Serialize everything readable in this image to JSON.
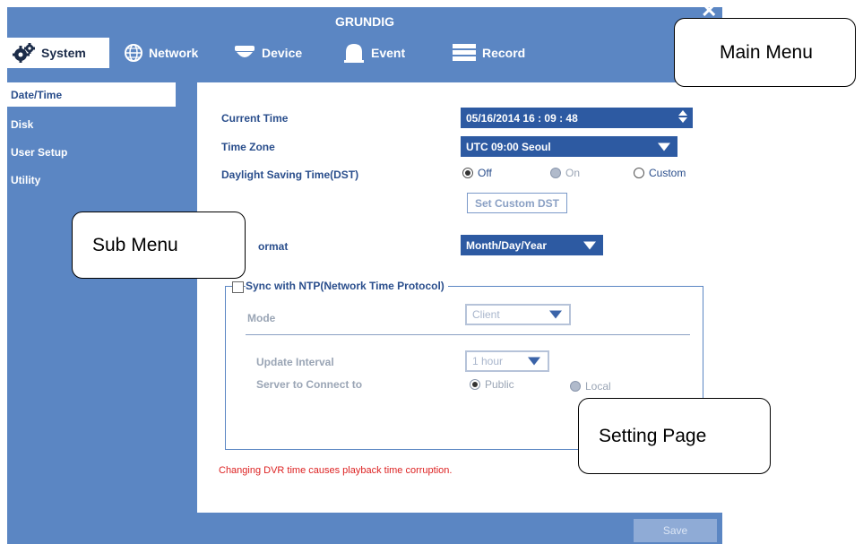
{
  "window": {
    "title": "GRUNDIG",
    "close_glyph": "✕"
  },
  "main_menu": [
    {
      "label": "System",
      "icon": "gear-icon",
      "active": true
    },
    {
      "label": "Network",
      "icon": "globe-icon"
    },
    {
      "label": "Device",
      "icon": "camera-icon"
    },
    {
      "label": "Event",
      "icon": "bell-icon"
    },
    {
      "label": "Record",
      "icon": "record-icon"
    }
  ],
  "sub_menu": [
    {
      "label": "Date/Time",
      "active": true
    },
    {
      "label": "Disk"
    },
    {
      "label": "User Setup"
    },
    {
      "label": "Utility"
    }
  ],
  "settings": {
    "current_time_label": "Current Time",
    "current_time_value": "05/16/2014  16 : 09 : 48",
    "time_zone_label": "Time Zone",
    "time_zone_value": "UTC 09:00 Seoul",
    "dst_label": "Daylight Saving Time(DST)",
    "dst_options": {
      "off": "Off",
      "on": "On",
      "custom": "Custom"
    },
    "dst_selected": "Off",
    "set_custom_dst_button": "Set Custom DST",
    "date_format_label": "ormat",
    "date_format_value": "Month/Day/Year",
    "ntp_label": "Sync with NTP(Network Time Protocol)",
    "mode_label": "Mode",
    "mode_value": "Client",
    "update_interval_label": "Update Interval",
    "update_interval_value": "1 hour",
    "server_label": "Server to Connect to",
    "server_options": {
      "public": "Public",
      "local": "Local"
    },
    "server_selected": "Public",
    "warning": "Changing DVR time causes playback time corruption.",
    "save_button": "Save"
  },
  "callouts": {
    "main_menu": "Main Menu",
    "sub_menu": "Sub Menu",
    "setting_page": "Setting Page"
  }
}
